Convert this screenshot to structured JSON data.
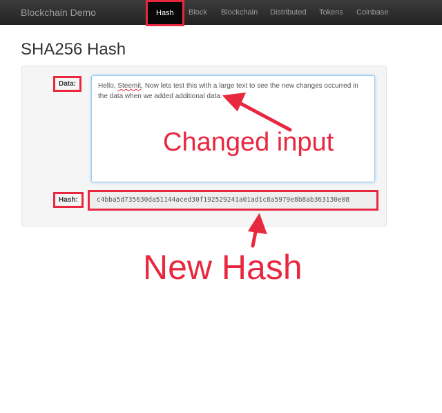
{
  "nav": {
    "brand": "Blockchain Demo",
    "items": [
      {
        "label": "Hash",
        "active": true
      },
      {
        "label": "Block"
      },
      {
        "label": "Blockchain"
      },
      {
        "label": "Distributed"
      },
      {
        "label": "Tokens"
      },
      {
        "label": "Coinbase"
      }
    ]
  },
  "page": {
    "title": "SHA256 Hash"
  },
  "form": {
    "data_label": "Data:",
    "data_pre": "Hello, ",
    "data_misspelled": "Steemit",
    "data_post": ", Now lets test this with a large text to see the new changes occurred in the data when we added additional data.",
    "hash_label": "Hash:",
    "hash_value": "c4bba5d735630da51144aced30f192529241a01ad1c8a5979e8b8ab363130e08"
  },
  "annotations": {
    "input": "Changed input",
    "hash": "New Hash",
    "color": "#e8283f"
  }
}
